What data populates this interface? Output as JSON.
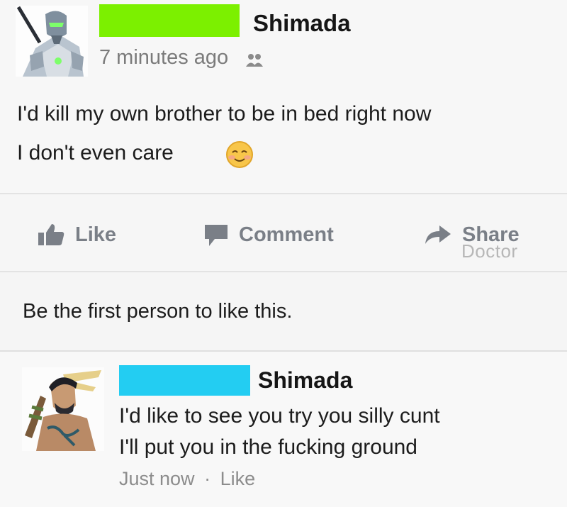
{
  "post": {
    "author_name": "Shimada",
    "name_redaction_color": "#7CF000",
    "timestamp": "7 minutes ago",
    "audience_icon": "friends-icon",
    "lines": [
      "I'd kill my own brother to be in bed right now",
      "I don't even care"
    ],
    "emoji": "smiling-face-emoji"
  },
  "actions": {
    "like_label": "Like",
    "comment_label": "Comment",
    "share_label": "Share",
    "watermark": "Doctor"
  },
  "likes_summary": "Be the first person to like this.",
  "comment": {
    "author_name": "Shimada",
    "name_redaction_color": "#23CDF2",
    "lines": [
      "I'd like to see you try you silly cunt",
      "I'll put you in the fucking ground"
    ],
    "time_label": "Just now",
    "separator": "·",
    "like_label": "Like"
  },
  "colors": {
    "background": "#f4f4f4",
    "action_text": "#7a7f87",
    "meta_text": "#7b7b7b"
  }
}
